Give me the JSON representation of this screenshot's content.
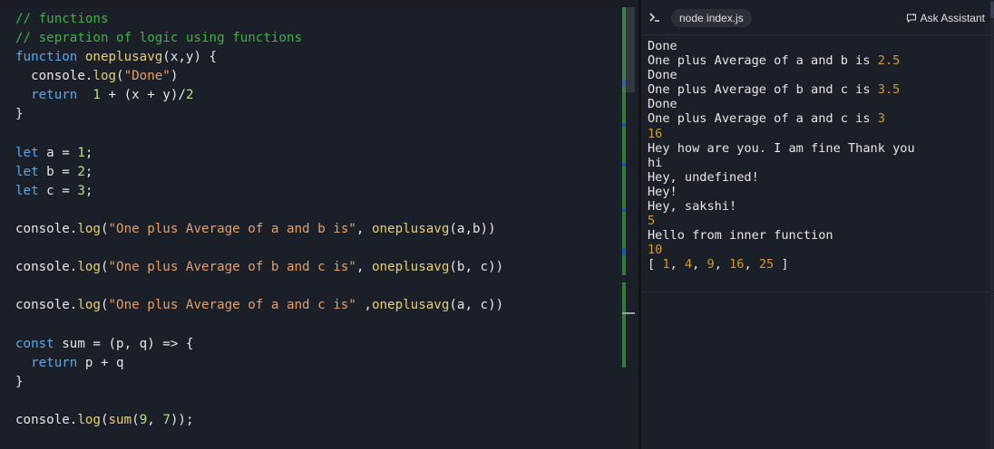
{
  "editor": {
    "lines": [
      [
        {
          "t": "// functions",
          "c": "comment"
        }
      ],
      [
        {
          "t": "// sepration of logic using functions",
          "c": "comment"
        }
      ],
      [
        {
          "t": "function ",
          "c": "kw"
        },
        {
          "t": "oneplusavg",
          "c": "fn"
        },
        {
          "t": "(x,y) {",
          "c": "plain"
        }
      ],
      [
        {
          "t": "  console.",
          "c": "plain"
        },
        {
          "t": "log",
          "c": "fn"
        },
        {
          "t": "(",
          "c": "plain"
        },
        {
          "t": "\"Done\"",
          "c": "str"
        },
        {
          "t": ")",
          "c": "plain"
        }
      ],
      [
        {
          "t": "  return  ",
          "c": "kw"
        },
        {
          "t": "1",
          "c": "num"
        },
        {
          "t": " + (x + y)/",
          "c": "plain"
        },
        {
          "t": "2",
          "c": "num"
        }
      ],
      [
        {
          "t": "}",
          "c": "plain"
        }
      ],
      [
        {
          "t": "",
          "c": "plain"
        }
      ],
      [
        {
          "t": "let ",
          "c": "kw"
        },
        {
          "t": "a = ",
          "c": "plain"
        },
        {
          "t": "1",
          "c": "num"
        },
        {
          "t": ";",
          "c": "plain"
        }
      ],
      [
        {
          "t": "let ",
          "c": "kw"
        },
        {
          "t": "b = ",
          "c": "plain"
        },
        {
          "t": "2",
          "c": "num"
        },
        {
          "t": ";",
          "c": "plain"
        }
      ],
      [
        {
          "t": "let ",
          "c": "kw"
        },
        {
          "t": "c = ",
          "c": "plain"
        },
        {
          "t": "3",
          "c": "num"
        },
        {
          "t": ";",
          "c": "plain"
        }
      ],
      [
        {
          "t": "",
          "c": "plain"
        }
      ],
      [
        {
          "t": "console.",
          "c": "plain"
        },
        {
          "t": "log",
          "c": "fn"
        },
        {
          "t": "(",
          "c": "plain"
        },
        {
          "t": "\"One plus Average of a and b is\"",
          "c": "str"
        },
        {
          "t": ", ",
          "c": "plain"
        },
        {
          "t": "oneplusavg",
          "c": "fn"
        },
        {
          "t": "(a,b))",
          "c": "plain"
        }
      ],
      [
        {
          "t": "",
          "c": "plain"
        }
      ],
      [
        {
          "t": "console.",
          "c": "plain"
        },
        {
          "t": "log",
          "c": "fn"
        },
        {
          "t": "(",
          "c": "plain"
        },
        {
          "t": "\"One plus Average of b and c is\"",
          "c": "str"
        },
        {
          "t": ", ",
          "c": "plain"
        },
        {
          "t": "oneplusavg",
          "c": "fn"
        },
        {
          "t": "(b, c))",
          "c": "plain"
        }
      ],
      [
        {
          "t": "",
          "c": "plain"
        }
      ],
      [
        {
          "t": "console.",
          "c": "plain"
        },
        {
          "t": "log",
          "c": "fn"
        },
        {
          "t": "(",
          "c": "plain"
        },
        {
          "t": "\"One plus Average of a and c is\"",
          "c": "str"
        },
        {
          "t": " ,",
          "c": "plain"
        },
        {
          "t": "oneplusavg",
          "c": "fn"
        },
        {
          "t": "(a, c))",
          "c": "plain"
        }
      ],
      [
        {
          "t": "",
          "c": "plain"
        }
      ],
      [
        {
          "t": "const ",
          "c": "kw"
        },
        {
          "t": "sum = (p, q) => {",
          "c": "plain"
        }
      ],
      [
        {
          "t": "  return ",
          "c": "kw"
        },
        {
          "t": "p + q",
          "c": "plain"
        }
      ],
      [
        {
          "t": "}",
          "c": "plain"
        }
      ],
      [
        {
          "t": "",
          "c": "plain"
        }
      ],
      [
        {
          "t": "console.",
          "c": "plain"
        },
        {
          "t": "log",
          "c": "fn"
        },
        {
          "t": "(",
          "c": "plain"
        },
        {
          "t": "sum",
          "c": "fn"
        },
        {
          "t": "(",
          "c": "plain"
        },
        {
          "t": "9",
          "c": "num"
        },
        {
          "t": ", ",
          "c": "plain"
        },
        {
          "t": "7",
          "c": "num"
        },
        {
          "t": "));",
          "c": "plain"
        }
      ]
    ],
    "scroll_markers_color": "#2e7d32"
  },
  "terminal": {
    "tab_label": "node index.js",
    "ask_label": "Ask Assistant",
    "output": [
      [
        {
          "t": "Done",
          "c": "plain"
        }
      ],
      [
        {
          "t": "One plus Average of a and b is ",
          "c": "plain"
        },
        {
          "t": "2.5",
          "c": "num"
        }
      ],
      [
        {
          "t": "Done",
          "c": "plain"
        }
      ],
      [
        {
          "t": "One plus Average of b and c is ",
          "c": "plain"
        },
        {
          "t": "3.5",
          "c": "num"
        }
      ],
      [
        {
          "t": "Done",
          "c": "plain"
        }
      ],
      [
        {
          "t": "One plus Average of a and c is ",
          "c": "plain"
        },
        {
          "t": "3",
          "c": "num"
        }
      ],
      [
        {
          "t": "16",
          "c": "num"
        }
      ],
      [
        {
          "t": "Hey how are you. I am fine Thank you",
          "c": "plain"
        }
      ],
      [
        {
          "t": "hi",
          "c": "plain"
        }
      ],
      [
        {
          "t": "Hey, undefined!",
          "c": "plain"
        }
      ],
      [
        {
          "t": "Hey!",
          "c": "plain"
        }
      ],
      [
        {
          "t": "Hey, sakshi!",
          "c": "plain"
        }
      ],
      [
        {
          "t": "5",
          "c": "num"
        }
      ],
      [
        {
          "t": "Hello from inner function",
          "c": "plain"
        }
      ],
      [
        {
          "t": "10",
          "c": "num"
        }
      ],
      [
        {
          "t": "[ ",
          "c": "plain"
        },
        {
          "t": "1",
          "c": "num"
        },
        {
          "t": ", ",
          "c": "plain"
        },
        {
          "t": "4",
          "c": "num"
        },
        {
          "t": ", ",
          "c": "plain"
        },
        {
          "t": "9",
          "c": "num"
        },
        {
          "t": ", ",
          "c": "plain"
        },
        {
          "t": "16",
          "c": "num"
        },
        {
          "t": ", ",
          "c": "plain"
        },
        {
          "t": "25",
          "c": "num"
        },
        {
          "t": " ]",
          "c": "plain"
        }
      ]
    ]
  },
  "colors": {
    "background": "#1b1f27",
    "comment": "#42b04a",
    "keyword": "#5ea6e6",
    "function": "#e5d07a",
    "string": "#e2a06c",
    "number": "#b9e08a",
    "terminal_number": "#d49a2a"
  },
  "icons": {
    "terminal_icon": "chevron-terminal-icon",
    "ask_icon": "chat-sparkle-icon"
  }
}
